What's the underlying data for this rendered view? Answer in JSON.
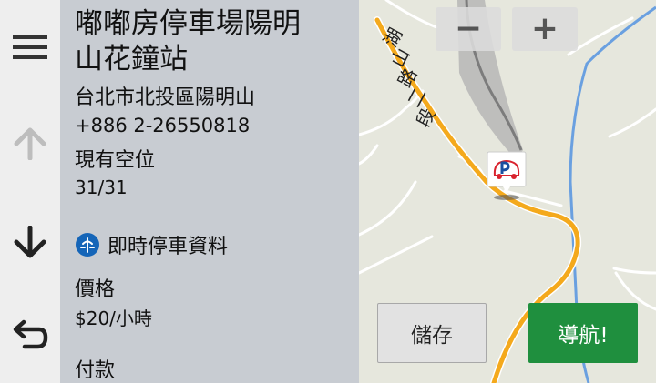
{
  "place": {
    "name_line1": "嘟嘟房停車場陽明",
    "name_line2": "山花鐘站",
    "address": "台北市北投區陽明山",
    "phone": "+886 2-26550818"
  },
  "availability": {
    "label": "現有空位",
    "value": "31/31"
  },
  "realtime": {
    "label": "即時停車資料"
  },
  "price": {
    "label": "價格",
    "value": "$20/小時"
  },
  "payment": {
    "label": "付款"
  },
  "map": {
    "road_label_chars": [
      "湖",
      "山",
      "路",
      "二",
      "段"
    ],
    "zoom_out_symbol": "−",
    "zoom_in_symbol": "+"
  },
  "actions": {
    "save_label": "儲存",
    "navigate_label": "導航!"
  },
  "icons": {
    "menu": "menu-icon",
    "up": "arrow-up-icon",
    "down": "arrow-down-icon",
    "back": "back-arrow-icon",
    "realtime": "realtime-parking-icon",
    "parking_marker": "parking-marker-icon"
  },
  "colors": {
    "panel_bg": "#c8ccd2",
    "rail_bg": "#eeeeee",
    "map_bg": "#e6e7dd",
    "road_orange": "#f4a91c",
    "river_blue": "#6aa0e0",
    "navigate_green": "#1f8f3e",
    "realtime_icon_blue": "#1565b8"
  }
}
